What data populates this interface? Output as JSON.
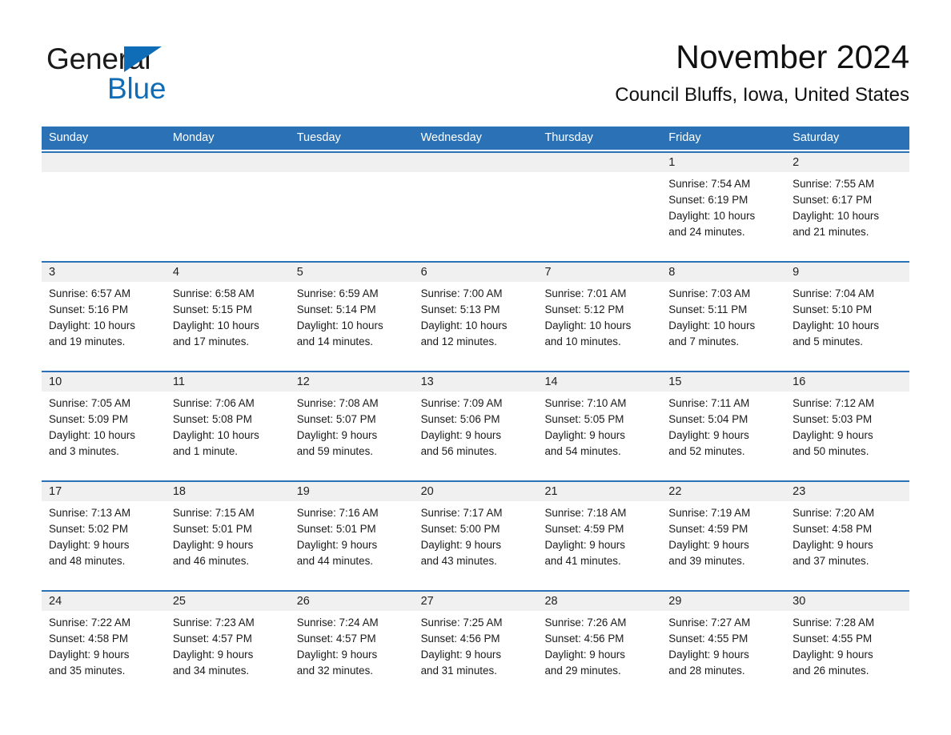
{
  "brand": {
    "name_part1": "General",
    "name_part2": "Blue",
    "triangle_color": "#0f6cb6"
  },
  "header": {
    "title": "November 2024",
    "subtitle": "Council Bluffs, Iowa, United States"
  },
  "theme": {
    "header_blue": "#2a72b5",
    "daynumber_band": "#f0f0f0",
    "text": "#1a1a1a"
  },
  "weekdays": [
    "Sunday",
    "Monday",
    "Tuesday",
    "Wednesday",
    "Thursday",
    "Friday",
    "Saturday"
  ],
  "weeks": [
    [
      {
        "day": "",
        "sunrise": "",
        "sunset": "",
        "daylight_line1": "",
        "daylight_line2": ""
      },
      {
        "day": "",
        "sunrise": "",
        "sunset": "",
        "daylight_line1": "",
        "daylight_line2": ""
      },
      {
        "day": "",
        "sunrise": "",
        "sunset": "",
        "daylight_line1": "",
        "daylight_line2": ""
      },
      {
        "day": "",
        "sunrise": "",
        "sunset": "",
        "daylight_line1": "",
        "daylight_line2": ""
      },
      {
        "day": "",
        "sunrise": "",
        "sunset": "",
        "daylight_line1": "",
        "daylight_line2": ""
      },
      {
        "day": "1",
        "sunrise": "Sunrise: 7:54 AM",
        "sunset": "Sunset: 6:19 PM",
        "daylight_line1": "Daylight: 10 hours",
        "daylight_line2": "and 24 minutes."
      },
      {
        "day": "2",
        "sunrise": "Sunrise: 7:55 AM",
        "sunset": "Sunset: 6:17 PM",
        "daylight_line1": "Daylight: 10 hours",
        "daylight_line2": "and 21 minutes."
      }
    ],
    [
      {
        "day": "3",
        "sunrise": "Sunrise: 6:57 AM",
        "sunset": "Sunset: 5:16 PM",
        "daylight_line1": "Daylight: 10 hours",
        "daylight_line2": "and 19 minutes."
      },
      {
        "day": "4",
        "sunrise": "Sunrise: 6:58 AM",
        "sunset": "Sunset: 5:15 PM",
        "daylight_line1": "Daylight: 10 hours",
        "daylight_line2": "and 17 minutes."
      },
      {
        "day": "5",
        "sunrise": "Sunrise: 6:59 AM",
        "sunset": "Sunset: 5:14 PM",
        "daylight_line1": "Daylight: 10 hours",
        "daylight_line2": "and 14 minutes."
      },
      {
        "day": "6",
        "sunrise": "Sunrise: 7:00 AM",
        "sunset": "Sunset: 5:13 PM",
        "daylight_line1": "Daylight: 10 hours",
        "daylight_line2": "and 12 minutes."
      },
      {
        "day": "7",
        "sunrise": "Sunrise: 7:01 AM",
        "sunset": "Sunset: 5:12 PM",
        "daylight_line1": "Daylight: 10 hours",
        "daylight_line2": "and 10 minutes."
      },
      {
        "day": "8",
        "sunrise": "Sunrise: 7:03 AM",
        "sunset": "Sunset: 5:11 PM",
        "daylight_line1": "Daylight: 10 hours",
        "daylight_line2": "and 7 minutes."
      },
      {
        "day": "9",
        "sunrise": "Sunrise: 7:04 AM",
        "sunset": "Sunset: 5:10 PM",
        "daylight_line1": "Daylight: 10 hours",
        "daylight_line2": "and 5 minutes."
      }
    ],
    [
      {
        "day": "10",
        "sunrise": "Sunrise: 7:05 AM",
        "sunset": "Sunset: 5:09 PM",
        "daylight_line1": "Daylight: 10 hours",
        "daylight_line2": "and 3 minutes."
      },
      {
        "day": "11",
        "sunrise": "Sunrise: 7:06 AM",
        "sunset": "Sunset: 5:08 PM",
        "daylight_line1": "Daylight: 10 hours",
        "daylight_line2": "and 1 minute."
      },
      {
        "day": "12",
        "sunrise": "Sunrise: 7:08 AM",
        "sunset": "Sunset: 5:07 PM",
        "daylight_line1": "Daylight: 9 hours",
        "daylight_line2": "and 59 minutes."
      },
      {
        "day": "13",
        "sunrise": "Sunrise: 7:09 AM",
        "sunset": "Sunset: 5:06 PM",
        "daylight_line1": "Daylight: 9 hours",
        "daylight_line2": "and 56 minutes."
      },
      {
        "day": "14",
        "sunrise": "Sunrise: 7:10 AM",
        "sunset": "Sunset: 5:05 PM",
        "daylight_line1": "Daylight: 9 hours",
        "daylight_line2": "and 54 minutes."
      },
      {
        "day": "15",
        "sunrise": "Sunrise: 7:11 AM",
        "sunset": "Sunset: 5:04 PM",
        "daylight_line1": "Daylight: 9 hours",
        "daylight_line2": "and 52 minutes."
      },
      {
        "day": "16",
        "sunrise": "Sunrise: 7:12 AM",
        "sunset": "Sunset: 5:03 PM",
        "daylight_line1": "Daylight: 9 hours",
        "daylight_line2": "and 50 minutes."
      }
    ],
    [
      {
        "day": "17",
        "sunrise": "Sunrise: 7:13 AM",
        "sunset": "Sunset: 5:02 PM",
        "daylight_line1": "Daylight: 9 hours",
        "daylight_line2": "and 48 minutes."
      },
      {
        "day": "18",
        "sunrise": "Sunrise: 7:15 AM",
        "sunset": "Sunset: 5:01 PM",
        "daylight_line1": "Daylight: 9 hours",
        "daylight_line2": "and 46 minutes."
      },
      {
        "day": "19",
        "sunrise": "Sunrise: 7:16 AM",
        "sunset": "Sunset: 5:01 PM",
        "daylight_line1": "Daylight: 9 hours",
        "daylight_line2": "and 44 minutes."
      },
      {
        "day": "20",
        "sunrise": "Sunrise: 7:17 AM",
        "sunset": "Sunset: 5:00 PM",
        "daylight_line1": "Daylight: 9 hours",
        "daylight_line2": "and 43 minutes."
      },
      {
        "day": "21",
        "sunrise": "Sunrise: 7:18 AM",
        "sunset": "Sunset: 4:59 PM",
        "daylight_line1": "Daylight: 9 hours",
        "daylight_line2": "and 41 minutes."
      },
      {
        "day": "22",
        "sunrise": "Sunrise: 7:19 AM",
        "sunset": "Sunset: 4:59 PM",
        "daylight_line1": "Daylight: 9 hours",
        "daylight_line2": "and 39 minutes."
      },
      {
        "day": "23",
        "sunrise": "Sunrise: 7:20 AM",
        "sunset": "Sunset: 4:58 PM",
        "daylight_line1": "Daylight: 9 hours",
        "daylight_line2": "and 37 minutes."
      }
    ],
    [
      {
        "day": "24",
        "sunrise": "Sunrise: 7:22 AM",
        "sunset": "Sunset: 4:58 PM",
        "daylight_line1": "Daylight: 9 hours",
        "daylight_line2": "and 35 minutes."
      },
      {
        "day": "25",
        "sunrise": "Sunrise: 7:23 AM",
        "sunset": "Sunset: 4:57 PM",
        "daylight_line1": "Daylight: 9 hours",
        "daylight_line2": "and 34 minutes."
      },
      {
        "day": "26",
        "sunrise": "Sunrise: 7:24 AM",
        "sunset": "Sunset: 4:57 PM",
        "daylight_line1": "Daylight: 9 hours",
        "daylight_line2": "and 32 minutes."
      },
      {
        "day": "27",
        "sunrise": "Sunrise: 7:25 AM",
        "sunset": "Sunset: 4:56 PM",
        "daylight_line1": "Daylight: 9 hours",
        "daylight_line2": "and 31 minutes."
      },
      {
        "day": "28",
        "sunrise": "Sunrise: 7:26 AM",
        "sunset": "Sunset: 4:56 PM",
        "daylight_line1": "Daylight: 9 hours",
        "daylight_line2": "and 29 minutes."
      },
      {
        "day": "29",
        "sunrise": "Sunrise: 7:27 AM",
        "sunset": "Sunset: 4:55 PM",
        "daylight_line1": "Daylight: 9 hours",
        "daylight_line2": "and 28 minutes."
      },
      {
        "day": "30",
        "sunrise": "Sunrise: 7:28 AM",
        "sunset": "Sunset: 4:55 PM",
        "daylight_line1": "Daylight: 9 hours",
        "daylight_line2": "and 26 minutes."
      }
    ]
  ]
}
